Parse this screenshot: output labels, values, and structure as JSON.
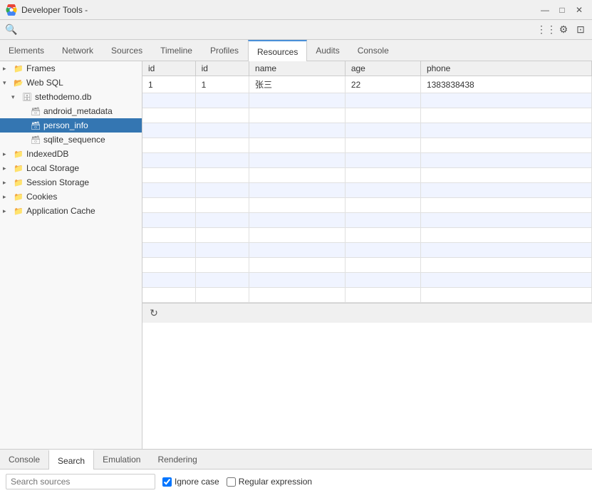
{
  "titleBar": {
    "title": "Developer Tools -",
    "controls": {
      "minimize": "—",
      "maximize": "□",
      "close": "✕"
    }
  },
  "toolbar": {
    "searchIcon": "🔍",
    "overflowIcon": "⋮⋮",
    "settingsIcon": "⚙",
    "undockIcon": "⊡"
  },
  "navTabs": [
    {
      "id": "elements",
      "label": "Elements"
    },
    {
      "id": "network",
      "label": "Network"
    },
    {
      "id": "sources",
      "label": "Sources"
    },
    {
      "id": "timeline",
      "label": "Timeline"
    },
    {
      "id": "profiles",
      "label": "Profiles"
    },
    {
      "id": "resources",
      "label": "Resources",
      "active": true
    },
    {
      "id": "audits",
      "label": "Audits"
    },
    {
      "id": "console",
      "label": "Console"
    }
  ],
  "sidebar": {
    "items": [
      {
        "id": "frames",
        "label": "Frames",
        "indent": 1,
        "type": "folder",
        "arrow": "closed"
      },
      {
        "id": "websql",
        "label": "Web SQL",
        "indent": 1,
        "type": "folder",
        "arrow": "open"
      },
      {
        "id": "stethodemo",
        "label": "stethodemo.db",
        "indent": 2,
        "type": "db",
        "arrow": "open"
      },
      {
        "id": "android_metadata",
        "label": "android_metadata",
        "indent": 3,
        "type": "table",
        "arrow": "leaf"
      },
      {
        "id": "person_info",
        "label": "person_info",
        "indent": 3,
        "type": "table",
        "arrow": "leaf",
        "selected": true
      },
      {
        "id": "sqlite_sequence",
        "label": "sqlite_sequence",
        "indent": 3,
        "type": "table",
        "arrow": "leaf"
      },
      {
        "id": "indexeddb",
        "label": "IndexedDB",
        "indent": 1,
        "type": "folder",
        "arrow": "closed"
      },
      {
        "id": "local_storage",
        "label": "Local Storage",
        "indent": 1,
        "type": "folder",
        "arrow": "closed"
      },
      {
        "id": "session_storage",
        "label": "Session Storage",
        "indent": 1,
        "type": "folder",
        "arrow": "closed"
      },
      {
        "id": "cookies",
        "label": "Cookies",
        "indent": 1,
        "type": "folder",
        "arrow": "closed"
      },
      {
        "id": "application_cache",
        "label": "Application Cache",
        "indent": 1,
        "type": "folder",
        "arrow": "closed"
      }
    ]
  },
  "dataTable": {
    "columns": [
      "id",
      "id",
      "name",
      "age",
      "phone"
    ],
    "rows": [
      [
        "1",
        "1",
        "张三",
        "22",
        "1383838438"
      ]
    ],
    "emptyRows": 14
  },
  "bottomTabs": [
    {
      "id": "console",
      "label": "Console"
    },
    {
      "id": "search",
      "label": "Search",
      "active": true
    },
    {
      "id": "emulation",
      "label": "Emulation"
    },
    {
      "id": "rendering",
      "label": "Rendering"
    }
  ],
  "search": {
    "placeholder": "Search sources",
    "value": "",
    "ignoreCase": {
      "label": "Ignore case",
      "checked": true
    },
    "regex": {
      "label": "Regular expression",
      "checked": false
    }
  }
}
